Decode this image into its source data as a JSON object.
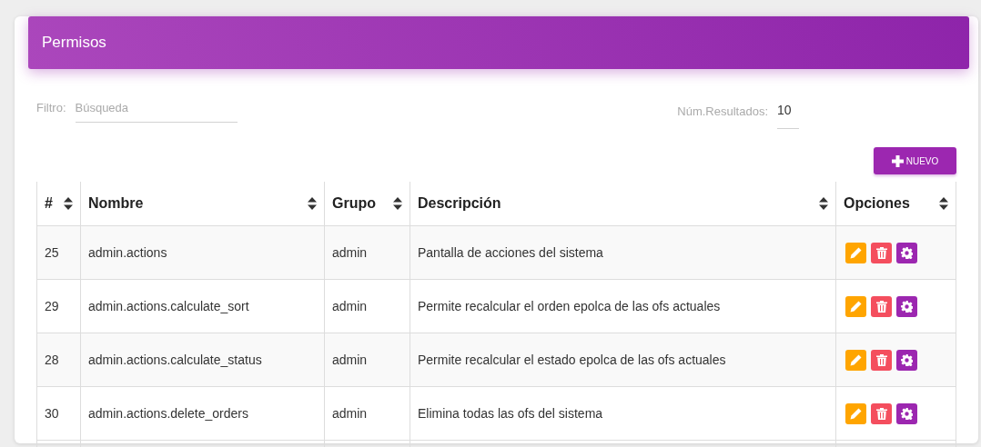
{
  "header": {
    "title": "Permisos"
  },
  "filter": {
    "label": "Filtro:",
    "placeholder": "Búsqueda"
  },
  "results": {
    "label": "Núm.Resultados:",
    "value": "10"
  },
  "new_button": {
    "label": "NUEVO"
  },
  "table": {
    "columns": [
      "#",
      "Nombre",
      "Grupo",
      "Descripción",
      "Opciones"
    ],
    "rows": [
      {
        "id": "25",
        "name": "admin.actions",
        "group": "admin",
        "description": "Pantalla de acciones del sistema"
      },
      {
        "id": "29",
        "name": "admin.actions.calculate_sort",
        "group": "admin",
        "description": "Permite recalcular el orden epolca de las ofs actuales"
      },
      {
        "id": "28",
        "name": "admin.actions.calculate_status",
        "group": "admin",
        "description": "Permite recalcular el estado epolca de las ofs actuales"
      },
      {
        "id": "30",
        "name": "admin.actions.delete_orders",
        "group": "admin",
        "description": "Elimina todas las ofs del sistema"
      }
    ]
  }
}
